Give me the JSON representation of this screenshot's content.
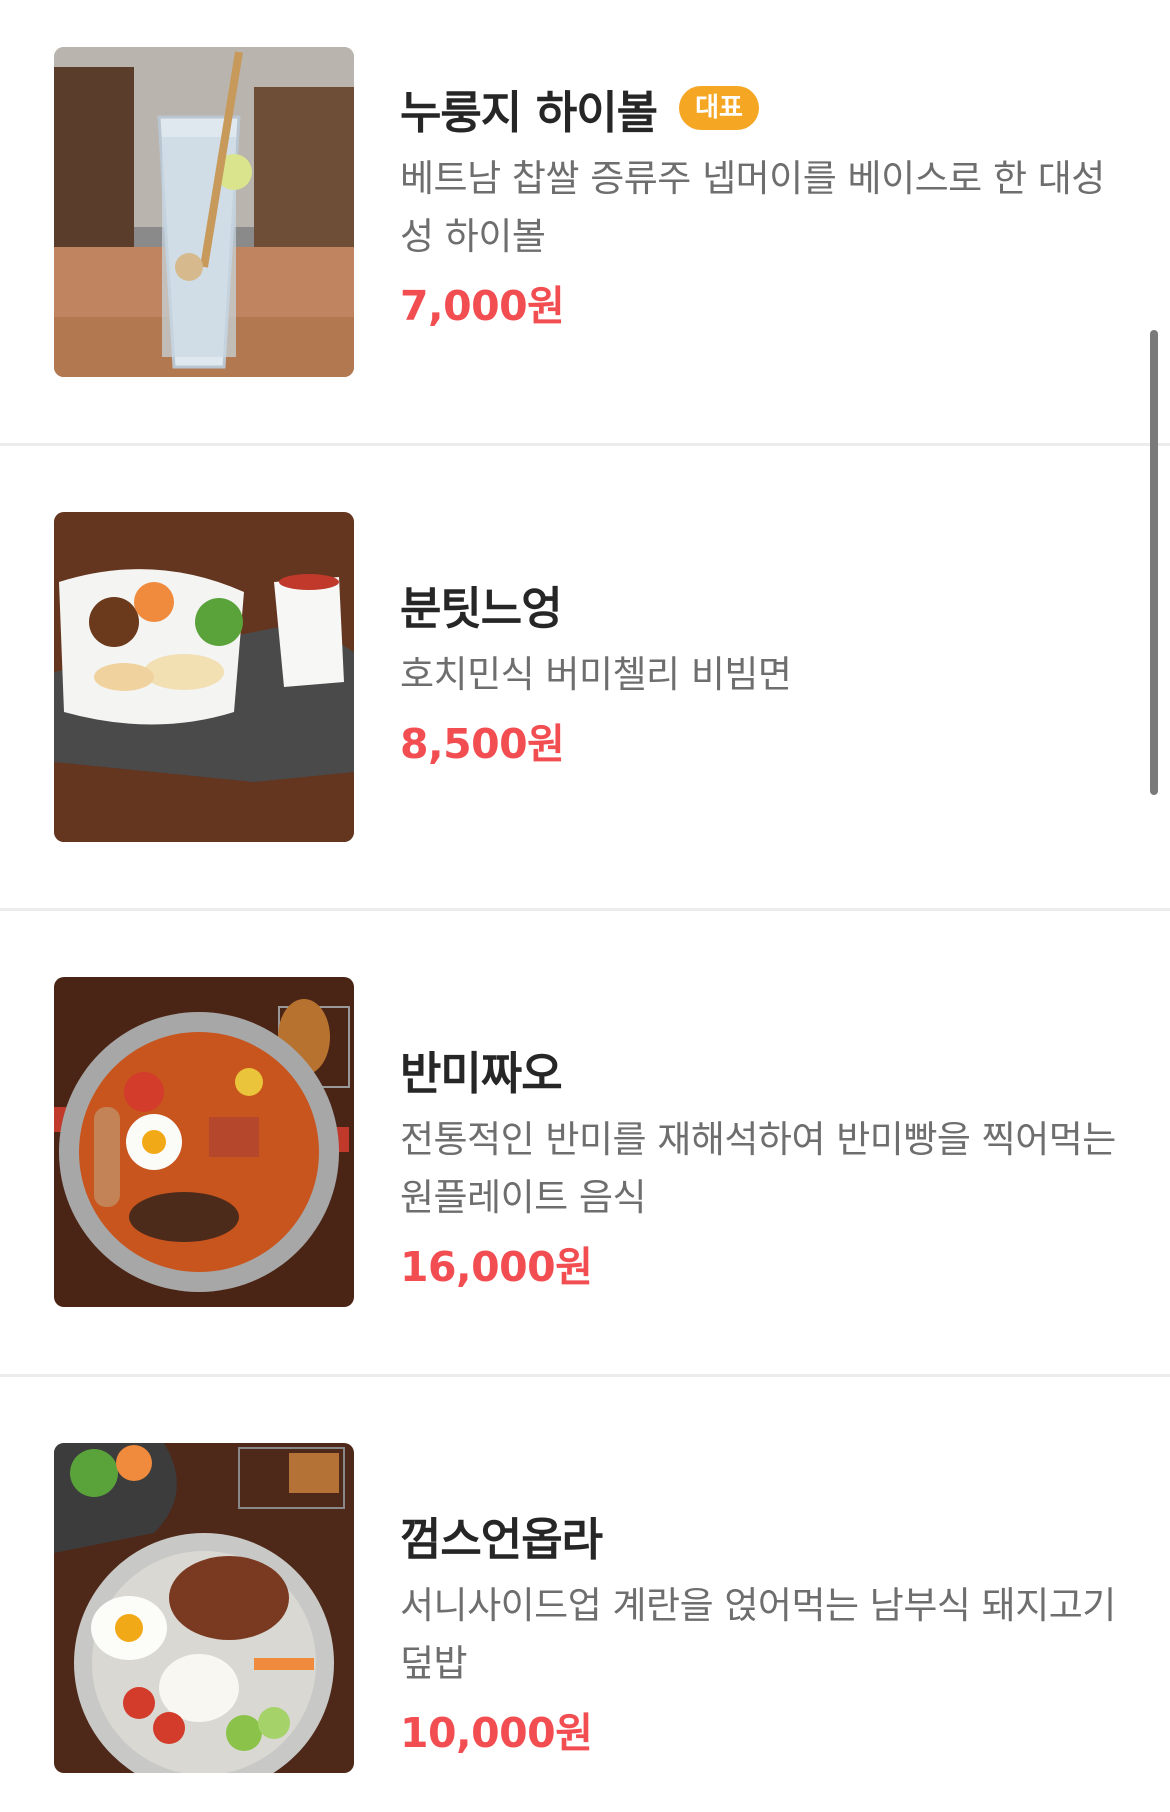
{
  "menu": {
    "items": [
      {
        "name": "누룽지 하이볼",
        "badge": "대표",
        "description": "베트남 찹쌀 증류주 넵머이를 베이스로 한 대성성 하이볼",
        "price": "7,000원"
      },
      {
        "name": "분팃느엉",
        "description": "호치민식 버미첼리 비빔면",
        "price": "8,500원"
      },
      {
        "name": "반미짜오",
        "description": "전통적인 반미를 재해석하여 반미빵을 찍어먹는 원플레이트 음식",
        "price": "16,000원"
      },
      {
        "name": "껌스언옵라",
        "description": "서니사이드업 계란을 얹어먹는 남부식 돼지고기 덮밥",
        "price": "10,000원"
      }
    ]
  },
  "colors": {
    "price": "#f24e52",
    "badge": "#f5a623",
    "title": "#262626",
    "description": "#6e6e6e",
    "divider": "#ececec"
  }
}
